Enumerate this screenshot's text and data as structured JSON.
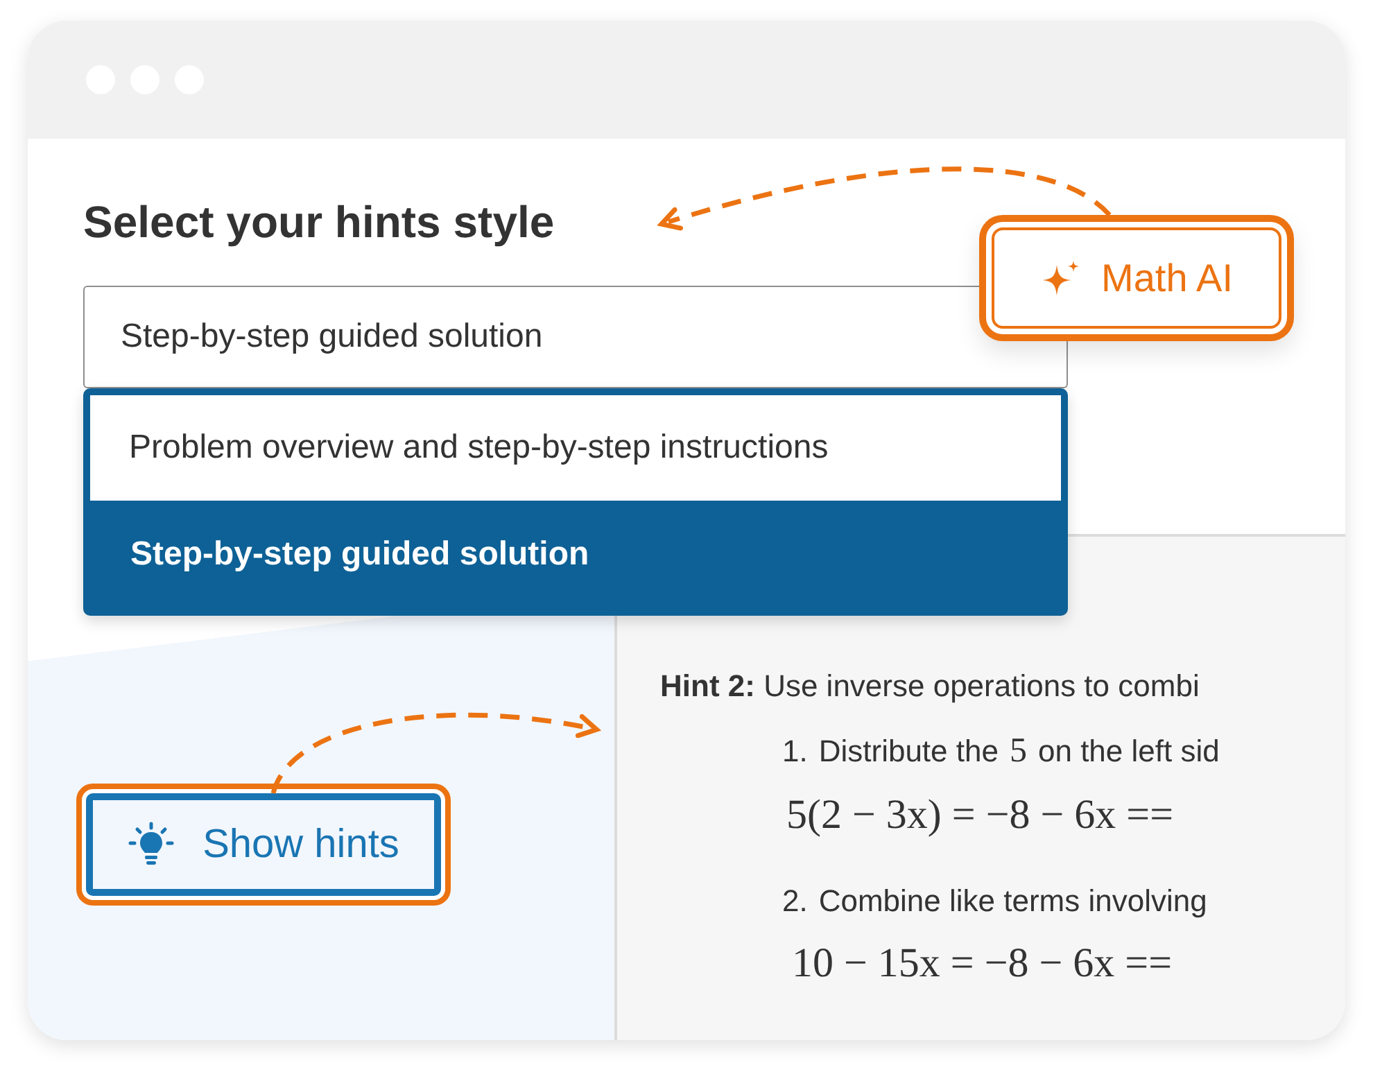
{
  "heading": "Select your hints style",
  "select": {
    "value": "Step-by-step guided solution"
  },
  "dropdown": [
    {
      "label": "Problem overview and step-by-step instructions",
      "selected": false
    },
    {
      "label": "Step-by-step guided solution",
      "selected": true
    }
  ],
  "math_ai_button": {
    "label": "Math AI"
  },
  "show_hints_button": {
    "label": "Show hints"
  },
  "hint": {
    "text": "**Hint 2:** Use inverse operations to combi",
    "steps": [
      {
        "number": "1.",
        "text": "Distribute the",
        "math": "5",
        "text_after": "on the left sid",
        "equation": "5(2 − 3x) = −8 − 6x =="
      },
      {
        "number": "2.",
        "text": "Combine like terms involving",
        "equation": "10 − 15x = −8 − 6x =="
      }
    ]
  }
}
